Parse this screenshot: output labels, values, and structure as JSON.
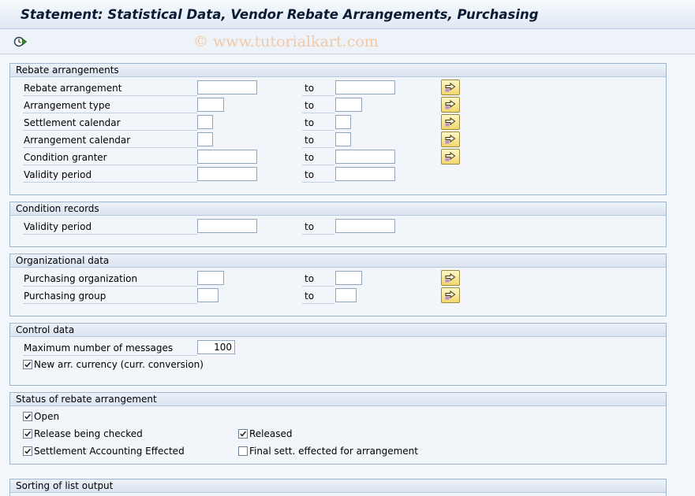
{
  "title": "Statement: Statistical Data, Vendor Rebate Arrangements, Purchasing",
  "toolbar": {
    "execute_icon": "execute-clock-icon",
    "watermark": "© www.tutorialkart.com"
  },
  "to_label": "to",
  "sections": {
    "rebate": {
      "title": "Rebate arrangements",
      "rows": [
        {
          "label": "Rebate arrangement",
          "from": "",
          "to": ""
        },
        {
          "label": "Arrangement type",
          "from": "",
          "to": ""
        },
        {
          "label": "Settlement calendar",
          "from": "",
          "to": ""
        },
        {
          "label": "Arrangement calendar",
          "from": "",
          "to": ""
        },
        {
          "label": "Condition granter",
          "from": "",
          "to": ""
        },
        {
          "label": "Validity period",
          "from": "",
          "to": ""
        }
      ]
    },
    "condition": {
      "title": "Condition records",
      "rows": [
        {
          "label": "Validity period",
          "from": "",
          "to": ""
        }
      ]
    },
    "org": {
      "title": "Organizational data",
      "rows": [
        {
          "label": "Purchasing organization",
          "from": "",
          "to": ""
        },
        {
          "label": "Purchasing group",
          "from": "",
          "to": ""
        }
      ]
    },
    "control": {
      "title": "Control data",
      "max_messages_label": "Maximum number of messages",
      "max_messages_value": "100",
      "currency_label": "New arr. currency (curr. conversion)",
      "currency_checked": true
    },
    "status": {
      "title": "Status of rebate arrangement",
      "open_label": "Open",
      "open_checked": true,
      "release_checked_label": "Release being checked",
      "release_checked_checked": true,
      "released_label": "Released",
      "released_checked": true,
      "settlement_label": "Settlement Accounting Effected",
      "settlement_checked": true,
      "final_label": "Final sett. effected for arrangement",
      "final_checked": false
    },
    "sorting": {
      "title": "Sorting of list output"
    }
  },
  "colors": {
    "accent_button": "#f0d66d",
    "header_bg": "#dae4f0",
    "border": "#9fb6d0"
  }
}
